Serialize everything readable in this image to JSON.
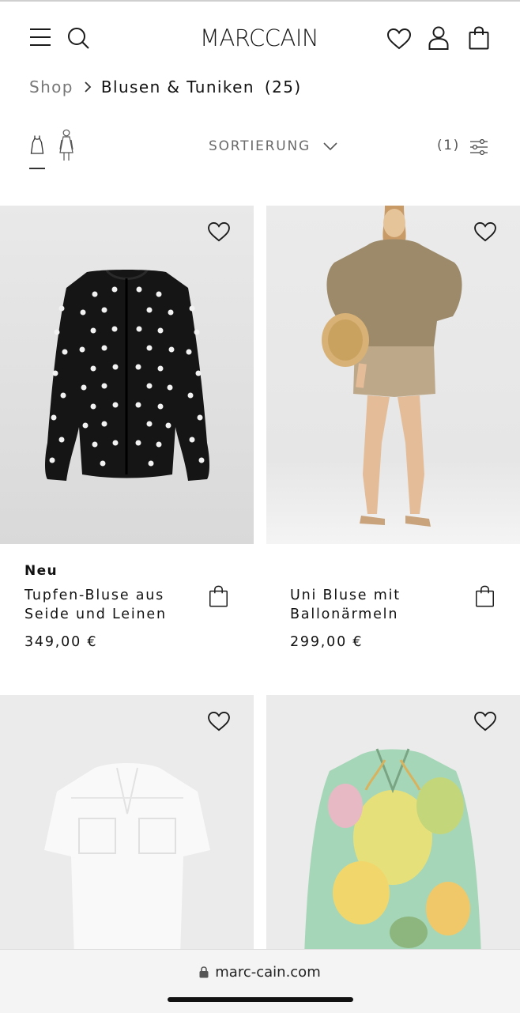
{
  "header": {
    "logo_text": "MARCCAIN",
    "icons": [
      "menu-icon",
      "search-icon",
      "wishlist-icon",
      "account-icon",
      "shopping-bag-icon"
    ]
  },
  "breadcrumb": {
    "shop": "Shop",
    "current": "Blusen & Tuniken",
    "count": "(25)"
  },
  "toolbar": {
    "view_icons": [
      "product-view-icon",
      "model-view-icon"
    ],
    "sort_label": "SORTIERUNG",
    "filter_count": "(1)"
  },
  "products": [
    {
      "badge": "Neu",
      "name": "Tupfen-Bluse aus Seide und Leinen",
      "price": "349,00 €"
    },
    {
      "badge": "",
      "name": "Uni Bluse mit Ballonärmeln",
      "price": "299,00 €"
    },
    {
      "badge": "",
      "name": "",
      "price": ""
    },
    {
      "badge": "",
      "name": "",
      "price": ""
    }
  ],
  "browser": {
    "url": "marc-cain.com"
  },
  "colors": {
    "text": "#1a1a1a",
    "muted": "#777777",
    "image_bg": "#ebebeb",
    "urlbar_bg": "#f4f4f4"
  }
}
